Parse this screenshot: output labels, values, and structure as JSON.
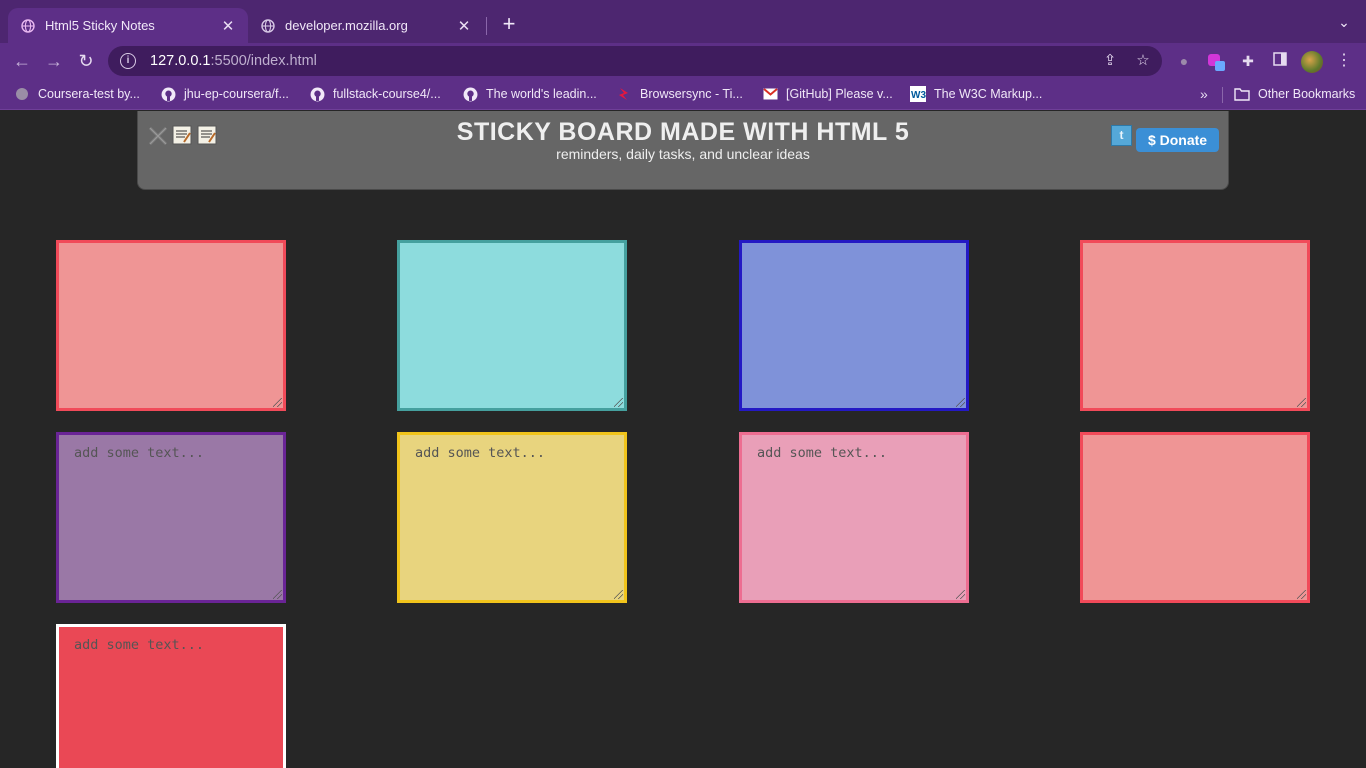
{
  "browser": {
    "tabs": [
      {
        "title": "Html5 Sticky Notes",
        "active": true
      },
      {
        "title": "developer.mozilla.org",
        "active": false
      }
    ],
    "url": {
      "host": "127.0.0.1",
      "path": ":5500/index.html"
    },
    "bookmarks": [
      {
        "label": "Coursera-test by...",
        "icon": "globe-icon"
      },
      {
        "label": "jhu-ep-coursera/f...",
        "icon": "github-icon"
      },
      {
        "label": "fullstack-course4/...",
        "icon": "github-icon"
      },
      {
        "label": "The world's leadin...",
        "icon": "github-icon"
      },
      {
        "label": "Browsersync - Ti...",
        "icon": "browsersync-icon"
      },
      {
        "label": "[GitHub] Please v...",
        "icon": "gmail-icon"
      },
      {
        "label": "The W3C Markup...",
        "icon": "w3c-icon"
      }
    ],
    "other_bookmarks": "Other Bookmarks",
    "colors": {
      "tabstrip": "#4d2670",
      "toolbar": "#5d2f87",
      "omnibox": "#3f1c5e"
    }
  },
  "page": {
    "title": "STICKY BOARD MADE WITH HTML 5",
    "subtitle": "reminders, daily tasks, and unclear ideas",
    "donate_label": "$ Donate",
    "note_placeholder": "add some text...",
    "notes": [
      {
        "bg": "#ef9595",
        "border": "#f14a59",
        "placeholder_visible": false
      },
      {
        "bg": "#8ddcdd",
        "border": "#45a09e",
        "placeholder_visible": false
      },
      {
        "bg": "#7f92d9",
        "border": "#2419c4",
        "placeholder_visible": false
      },
      {
        "bg": "#ef9595",
        "border": "#f14a59",
        "placeholder_visible": false
      },
      {
        "bg": "#9a78a6",
        "border": "#6a2496",
        "placeholder_visible": true
      },
      {
        "bg": "#e8d47e",
        "border": "#f1c41b",
        "placeholder_visible": true
      },
      {
        "bg": "#e99fb8",
        "border": "#ed6d91",
        "placeholder_visible": true
      },
      {
        "bg": "#ef9595",
        "border": "#f14a59",
        "placeholder_visible": false
      },
      {
        "bg": "#ea4855",
        "border": "#ffffff",
        "placeholder_visible": true
      }
    ]
  }
}
